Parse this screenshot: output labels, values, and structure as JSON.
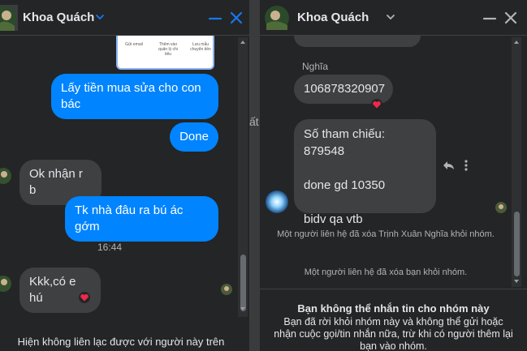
{
  "left_chat": {
    "contact_name": "Khoa Quách",
    "preview_card_labels": [
      "Gửi email",
      "Thêm vào quản lý chi tiêu",
      "Lưu mẫu chuyển tiền"
    ],
    "messages": [
      {
        "text": "Lấy tiền mua sửa cho con bác",
        "direction": "outgoing"
      },
      {
        "text": "Done",
        "direction": "outgoing"
      },
      {
        "text": "Ok nhận r b",
        "direction": "incoming"
      },
      {
        "text": "Tk nhà đâu ra bú ác gớm",
        "direction": "outgoing"
      },
      {
        "text": "Kkk,có e hú",
        "direction": "incoming",
        "reaction": "heart"
      }
    ],
    "timestamp": "16:44",
    "footer_text": "Hiện không liên lạc được với người này trên"
  },
  "right_chat": {
    "contact_name": "Khoa Quách",
    "sender_label": "Nghĩa",
    "messages": [
      {
        "text": "10687832090 7",
        "display": "106878320907",
        "direction": "incoming",
        "reaction": "heart"
      },
      {
        "lines": [
          "Số tham chiếu: 879548",
          "done gd 10350",
          "bidv qa vtb"
        ],
        "direction": "incoming"
      }
    ],
    "system_notices": [
      "Một người liên hệ đã xóa Trịnh Xuân Nghĩa khỏi nhóm.",
      "Một người liên hệ đã xóa bạn khỏi nhóm."
    ],
    "banner_title": "Bạn không thể nhắn tin cho nhóm này",
    "banner_body": "Bạn đã rời khỏi nhóm này và không thể gửi hoặc nhận cuộc gọi/tin nhắn nữa, trừ khi có người thêm lại bạn vào nhóm."
  },
  "background_peek_text": "ất",
  "colors": {
    "outgoing_bubble": "#0084ff",
    "incoming_bubble": "#3e4042",
    "window_bg": "#242526",
    "accent_icons": "#1877f2",
    "heart": "#f02849"
  }
}
